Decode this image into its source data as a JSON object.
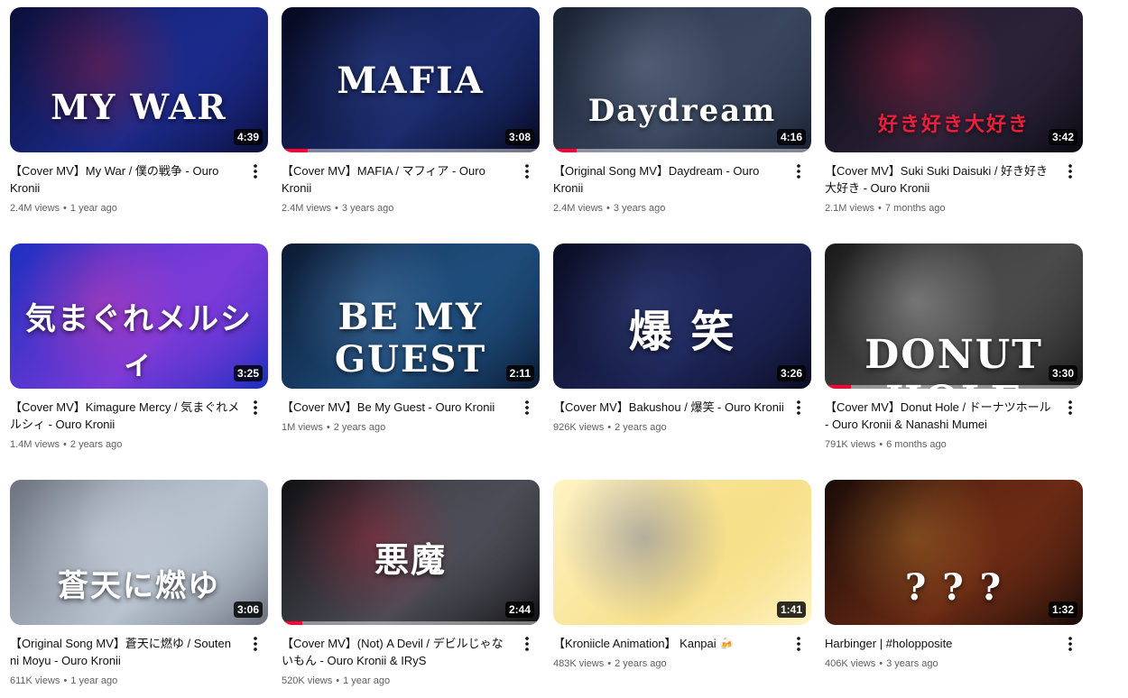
{
  "videos": [
    {
      "title": "【Cover MV】My War / 僕の戦争 - Ouro Kronii",
      "views": "2.4M views",
      "age": "1 year ago",
      "duration": "4:39",
      "overlay": "MY WAR",
      "progress": 0,
      "colors": [
        "#0b0f3a",
        "#1b2a8a",
        "#c81a2a"
      ]
    },
    {
      "title": "【Cover MV】MAFIA / マフィア - Ouro Kronii",
      "views": "2.4M views",
      "age": "3 years ago",
      "duration": "3:08",
      "overlay": "MAFIA",
      "progress": 0.1,
      "colors": [
        "#05081e",
        "#1a2a6a",
        "#3f56b0"
      ]
    },
    {
      "title": "【Original Song MV】Daydream - Ouro Kronii",
      "views": "2.4M views",
      "age": "3 years ago",
      "duration": "4:16",
      "overlay": "Daydream",
      "progress": 0.09,
      "colors": [
        "#1a2233",
        "#39465e",
        "#90a0b8"
      ]
    },
    {
      "title": "【Cover MV】Suki Suki Daisuki / 好き好き大好き - Ouro Kronii",
      "views": "2.1M views",
      "age": "7 months ago",
      "duration": "3:42",
      "overlay": "好き好き大好き",
      "progress": 0,
      "colors": [
        "#0a0a12",
        "#2c2238",
        "#d81f4a"
      ]
    },
    {
      "title": "【Cover MV】Kimagure Mercy / 気まぐれメルシィ - Ouro Kronii",
      "views": "1.4M views",
      "age": "2 years ago",
      "duration": "3:25",
      "overlay": "気まぐれメルシィ",
      "progress": 0,
      "colors": [
        "#1c2fbf",
        "#7a3ad8",
        "#ff3f9a"
      ]
    },
    {
      "title": "【Cover MV】Be My Guest - Ouro Kronii",
      "views": "1M views",
      "age": "2 years ago",
      "duration": "2:11",
      "overlay": "BE MY GUEST",
      "progress": 0,
      "colors": [
        "#0b1a33",
        "#1e4c7a",
        "#6fa2d8"
      ]
    },
    {
      "title": "【Cover MV】Bakushou / 爆笑 - Ouro Kronii",
      "views": "926K views",
      "age": "2 years ago",
      "duration": "3:26",
      "overlay": "爆  笑",
      "progress": 0,
      "colors": [
        "#0b0d24",
        "#1d2557",
        "#4b5fa8"
      ]
    },
    {
      "title": "【Cover MV】Donut Hole / ドーナツホール - Ouro Kronii & Nanashi Mumei",
      "views": "791K views",
      "age": "6 months ago",
      "duration": "3:30",
      "overlay": "DONUT HOLE",
      "progress": 0.1,
      "colors": [
        "#1a1a1a",
        "#4a4a4a",
        "#e9e9e9"
      ]
    },
    {
      "title": "【Original Song MV】蒼天に燃ゆ / Souten ni Moyu - Ouro Kronii",
      "views": "611K views",
      "age": "1 year ago",
      "duration": "3:06",
      "overlay": "蒼天に燃ゆ",
      "progress": 0,
      "colors": [
        "#6d7480",
        "#b8c2cf",
        "#e6ecf2"
      ]
    },
    {
      "title": "【Cover MV】(Not) A Devil / デビルじゃないもん - Ouro Kronii & IRyS",
      "views": "520K views",
      "age": "1 year ago",
      "duration": "2:44",
      "overlay": "悪魔",
      "progress": 0.08,
      "colors": [
        "#111114",
        "#4c4c56",
        "#d8243e"
      ]
    },
    {
      "title": "【Kroniicle Animation】 Kanpai 🍻",
      "views": "483K views",
      "age": "2 years ago",
      "duration": "1:41",
      "overlay": "",
      "progress": 0,
      "colors": [
        "#fff3c4",
        "#f7e08a",
        "#2a3f9a"
      ]
    },
    {
      "title": "Harbinger | #holopposite",
      "views": "406K views",
      "age": "3 years ago",
      "duration": "1:32",
      "overlay": "? ? ?",
      "progress": 0,
      "colors": [
        "#1a0c08",
        "#6a2a14",
        "#d89a3a"
      ]
    }
  ]
}
